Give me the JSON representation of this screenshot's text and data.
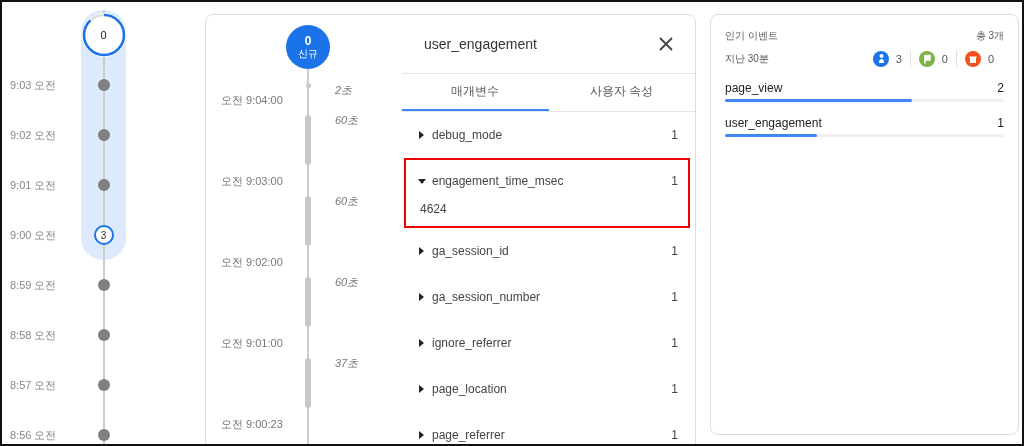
{
  "minute_timeline": {
    "top_count": "0",
    "minutes": [
      {
        "time": "9:03 오전",
        "kind": "dot",
        "highlighted": true
      },
      {
        "time": "9:02 오전",
        "kind": "dot",
        "highlighted": true
      },
      {
        "time": "9:01 오전",
        "kind": "dot",
        "highlighted": true
      },
      {
        "time": "9:00 오전",
        "kind": "count",
        "count": "3",
        "highlighted": true
      },
      {
        "time": "8:59 오전",
        "kind": "dot",
        "highlighted": false
      },
      {
        "time": "8:58 오전",
        "kind": "dot",
        "highlighted": false
      },
      {
        "time": "8:57 오전",
        "kind": "dot",
        "highlighted": false
      },
      {
        "time": "8:56 오전",
        "kind": "dot",
        "highlighted": false
      }
    ]
  },
  "session_timeline": {
    "badge": {
      "count": "0",
      "label": "신규"
    },
    "first_gap": "2초",
    "events": [
      {
        "time": "오전 9:04:00",
        "gap": "60초"
      },
      {
        "time": "오전 9:03:00",
        "gap": "60초"
      },
      {
        "time": "오전 9:02:00",
        "gap": "60초"
      },
      {
        "time": "오전 9:01:00",
        "gap": "37초"
      },
      {
        "time": "오전 9:00:23"
      }
    ]
  },
  "event_detail": {
    "title": "user_engagement",
    "tabs": [
      {
        "label": "매개변수",
        "selected": true
      },
      {
        "label": "사용자 속성",
        "selected": false
      }
    ],
    "parameters": [
      {
        "name": "debug_mode",
        "count": "1",
        "expanded": false,
        "highlighted": false
      },
      {
        "name": "engagement_time_msec",
        "count": "1",
        "expanded": true,
        "value": "4624",
        "highlighted": true
      },
      {
        "name": "ga_session_id",
        "count": "1",
        "expanded": false,
        "highlighted": false
      },
      {
        "name": "ga_session_number",
        "count": "1",
        "expanded": false,
        "highlighted": false
      },
      {
        "name": "ignore_referrer",
        "count": "1",
        "expanded": false,
        "highlighted": false
      },
      {
        "name": "page_location",
        "count": "1",
        "expanded": false,
        "highlighted": false
      },
      {
        "name": "page_referrer",
        "count": "1",
        "expanded": false,
        "highlighted": false
      }
    ]
  },
  "top_events": {
    "title": "인기 이벤트",
    "total": "총 3개",
    "period": "지난 30분",
    "stats": [
      {
        "kind": "person",
        "count": "3",
        "color": "#1a73e8"
      },
      {
        "kind": "flag",
        "count": "0",
        "color": "#7cb342"
      },
      {
        "kind": "gift",
        "count": "0",
        "color": "#f4511e"
      }
    ],
    "events": [
      {
        "name": "page_view",
        "count": "2",
        "level": 0.67
      },
      {
        "name": "user_engagement",
        "count": "1",
        "level": 0.33
      }
    ]
  }
}
